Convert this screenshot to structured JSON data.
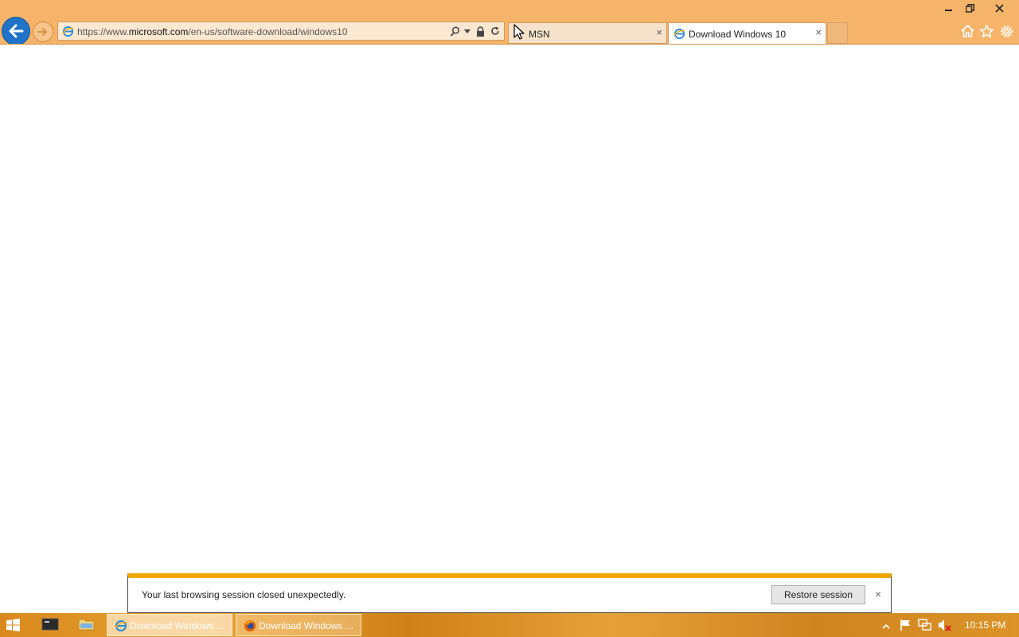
{
  "browser": {
    "url_prefix": "https://www.",
    "url_domain": "microsoft.com",
    "url_path": "/en-us/software-download/windows10",
    "tabs": [
      {
        "label": "MSN",
        "close": "×"
      },
      {
        "label": "Download Windows 10",
        "close": "×"
      }
    ]
  },
  "notification": {
    "message": "Your last browsing session closed unexpectedly.",
    "restore_label": "Restore session",
    "close": "×"
  },
  "taskbar": {
    "windows": [
      {
        "label": "Download Windows ..."
      },
      {
        "label": "Download Windows ..."
      }
    ],
    "clock": "10:15 PM"
  },
  "colors": {
    "chrome": "#f5b46a",
    "accent_blue": "#1f73c8",
    "notif_bar": "#f0a800",
    "taskbar": "#d9891c"
  }
}
